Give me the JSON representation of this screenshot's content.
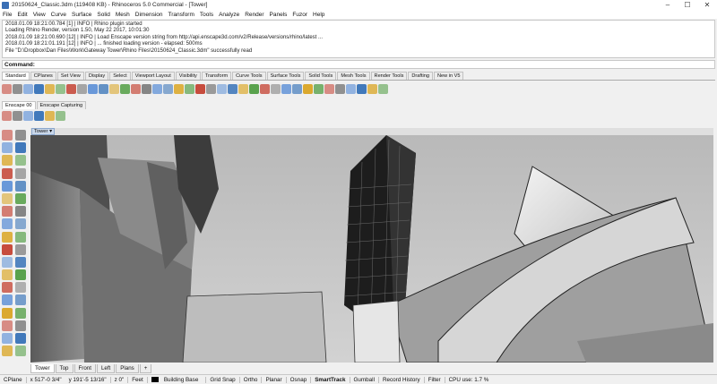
{
  "window": {
    "title": "20150624_Classic.3dm (119408 KB) - Rhinoceros 5.0 Commercial - [Tower]",
    "controls": [
      "–",
      "☐",
      "✕"
    ]
  },
  "menu": [
    "File",
    "Edit",
    "View",
    "Curve",
    "Surface",
    "Solid",
    "Mesh",
    "Dimension",
    "Transform",
    "Tools",
    "Analyze",
    "Render",
    "Panels",
    "Fuzor",
    "Help"
  ],
  "history": [
    "2018.01.09 18:21:00.784 [1] | INFO | Rhino plugin started",
    "Loading Rhino Render, version 1.50, May 22 2017, 10:01:30",
    "2018.01.09 18:21:00.690 [12] | INFO | Load Enscape version string from http://api.enscape3d.com/v2/Release/versions/rhino/latest ...",
    "2018.01.09 18:21:01.191 [12] | INFO | ... finished loading version - elapsed: 500ms",
    "File \"D:\\Dropbox\\Dan Files\\Work\\Gateway Tower\\Rhino Files\\20150624_Classic.3dm\" successfully read"
  ],
  "command": {
    "label": "Command:",
    "value": ""
  },
  "toolbar_tabs": [
    "Standard",
    "CPlanes",
    "Set View",
    "Display",
    "Select",
    "Viewport Layout",
    "Visibility",
    "Transform",
    "Curve Tools",
    "Surface Tools",
    "Solid Tools",
    "Mesh Tools",
    "Render Tools",
    "Drafting",
    "New in V5"
  ],
  "active_toolbar_tab": "Standard",
  "plugin_tabs": [
    "Enscape 00",
    "Enscape Capturing"
  ],
  "viewport": {
    "name": "Tower",
    "tabs": [
      "Tower",
      "Top",
      "Front",
      "Left",
      "Plans",
      "+"
    ]
  },
  "status": {
    "cplane": "CPlane",
    "x": "x 517'-0 3/4\"",
    "y": "y 191'-5 13/16\"",
    "z": "z 0\"",
    "units": "Feet",
    "layer": "Building Base",
    "toggles": [
      "Grid Snap",
      "Ortho",
      "Planar",
      "Osnap",
      "SmartTrack",
      "Gumball",
      "Record History",
      "Filter"
    ],
    "cpu": "CPU use: 1.7 %"
  },
  "icon_colors": [
    "#2f6db5",
    "#d9a21b",
    "#4a9a3c",
    "#c23b2b",
    "#7a7a7a",
    "#5b8fd6"
  ]
}
